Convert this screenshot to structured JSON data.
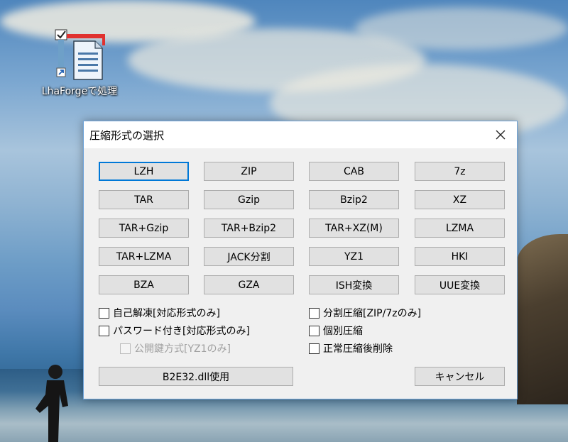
{
  "desktop": {
    "icon_label": "LhaForgeで処理"
  },
  "dialog": {
    "title": "圧縮形式の選択",
    "formats": [
      [
        "LZH",
        "ZIP",
        "CAB",
        "7z"
      ],
      [
        "TAR",
        "Gzip",
        "Bzip2",
        "XZ"
      ],
      [
        "TAR+Gzip",
        "TAR+Bzip2",
        "TAR+XZ(M)",
        "LZMA"
      ],
      [
        "TAR+LZMA",
        "JACK分割",
        "YZ1",
        "HKI"
      ],
      [
        "BZA",
        "GZA",
        "ISH変換",
        "UUE変換"
      ]
    ],
    "options_left": [
      {
        "label": "自己解凍[対応形式のみ]",
        "checked": false,
        "enabled": true
      },
      {
        "label": "パスワード付き[対応形式のみ]",
        "checked": false,
        "enabled": true
      },
      {
        "label": "公開鍵方式[YZ1のみ]",
        "checked": false,
        "enabled": false
      }
    ],
    "options_right": [
      {
        "label": "分割圧縮[ZIP/7zのみ]",
        "checked": false,
        "enabled": true
      },
      {
        "label": "個別圧縮",
        "checked": false,
        "enabled": true
      },
      {
        "label": "正常圧縮後削除",
        "checked": false,
        "enabled": true
      }
    ],
    "b2e_button": "B2E32.dll使用",
    "cancel_button": "キャンセル"
  },
  "colors": {
    "accent": "#0078d7",
    "button_face": "#e1e1e1",
    "dialog_bg": "#f0f0f0"
  }
}
